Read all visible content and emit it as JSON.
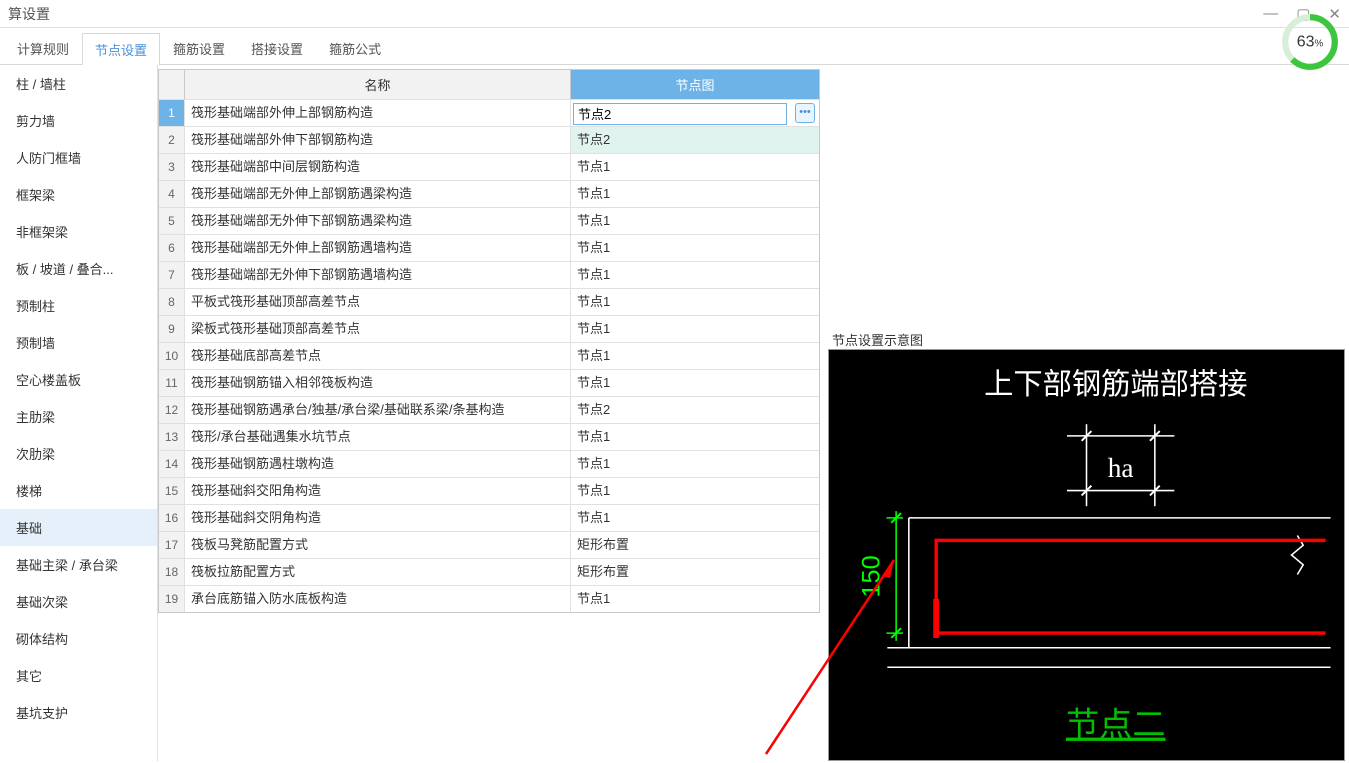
{
  "window": {
    "title": "算设置"
  },
  "tabs": [
    {
      "label": "计算规则"
    },
    {
      "label": "节点设置"
    },
    {
      "label": "箍筋设置"
    },
    {
      "label": "搭接设置"
    },
    {
      "label": "箍筋公式"
    }
  ],
  "active_tab_index": 1,
  "sidebar": {
    "items": [
      "柱 / 墙柱",
      "剪力墙",
      "人防门框墙",
      "框架梁",
      "非框架梁",
      "板 / 坡道 / 叠合...",
      "预制柱",
      "预制墙",
      "空心楼盖板",
      "主肋梁",
      "次肋梁",
      "楼梯",
      "基础",
      "基础主梁 / 承台梁",
      "基础次梁",
      "砌体结构",
      "其它",
      "基坑支护"
    ],
    "active_index": 12
  },
  "table": {
    "header": {
      "name": "名称",
      "diagram": "节点图"
    },
    "selected_index": 0,
    "rows": [
      {
        "idx": 1,
        "name": "筏形基础端部外伸上部钢筋构造",
        "diagram": "节点2",
        "editing": true
      },
      {
        "idx": 2,
        "name": "筏形基础端部外伸下部钢筋构造",
        "diagram": "节点2",
        "highlight": true
      },
      {
        "idx": 3,
        "name": "筏形基础端部中间层钢筋构造",
        "diagram": "节点1"
      },
      {
        "idx": 4,
        "name": "筏形基础端部无外伸上部钢筋遇梁构造",
        "diagram": "节点1"
      },
      {
        "idx": 5,
        "name": "筏形基础端部无外伸下部钢筋遇梁构造",
        "diagram": "节点1"
      },
      {
        "idx": 6,
        "name": "筏形基础端部无外伸上部钢筋遇墙构造",
        "diagram": "节点1"
      },
      {
        "idx": 7,
        "name": "筏形基础端部无外伸下部钢筋遇墙构造",
        "diagram": "节点1"
      },
      {
        "idx": 8,
        "name": "平板式筏形基础顶部高差节点",
        "diagram": "节点1"
      },
      {
        "idx": 9,
        "name": "梁板式筏形基础顶部高差节点",
        "diagram": "节点1"
      },
      {
        "idx": 10,
        "name": "筏形基础底部高差节点",
        "diagram": "节点1"
      },
      {
        "idx": 11,
        "name": "筏形基础钢筋锚入相邻筏板构造",
        "diagram": "节点1"
      },
      {
        "idx": 12,
        "name": "筏形基础钢筋遇承台/独基/承台梁/基础联系梁/条基构造",
        "diagram": "节点2"
      },
      {
        "idx": 13,
        "name": "筏形/承台基础遇集水坑节点",
        "diagram": "节点1"
      },
      {
        "idx": 14,
        "name": "筏形基础钢筋遇柱墩构造",
        "diagram": "节点1"
      },
      {
        "idx": 15,
        "name": "筏形基础斜交阳角构造",
        "diagram": "节点1"
      },
      {
        "idx": 16,
        "name": "筏形基础斜交阴角构造",
        "diagram": "节点1"
      },
      {
        "idx": 17,
        "name": "筏板马凳筋配置方式",
        "diagram": "矩形布置"
      },
      {
        "idx": 18,
        "name": "筏板拉筋配置方式",
        "diagram": "矩形布置"
      },
      {
        "idx": 19,
        "name": "承台底筋锚入防水底板构造",
        "diagram": "节点1"
      }
    ]
  },
  "progress": {
    "value": 63,
    "suffix": "%"
  },
  "preview": {
    "label": "节点设置示意图",
    "title_text": "上下部钢筋端部搭接",
    "dim_label_ha": "ha",
    "dim_label_150": "150",
    "caption": "节点二"
  },
  "ellipsis_glyph": "•••"
}
